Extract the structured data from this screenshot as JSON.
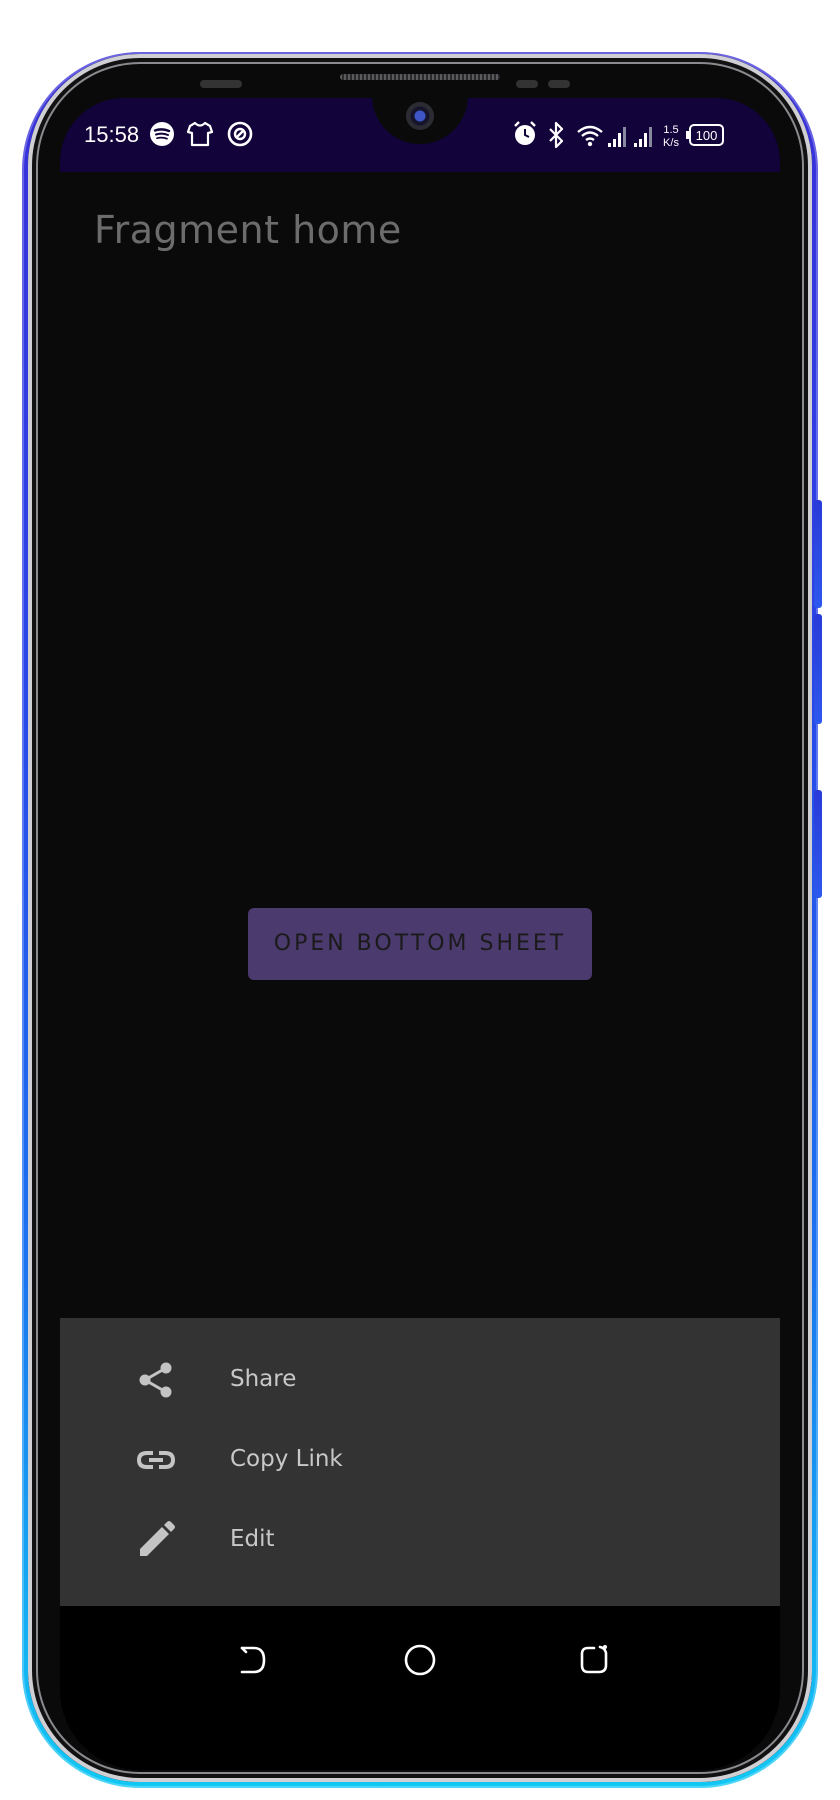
{
  "status_bar": {
    "time": "15:58",
    "left_icons": [
      "spotify-icon",
      "shirt-icon",
      "assistant-icon"
    ],
    "right_icons": [
      "alarm-icon",
      "bluetooth-icon",
      "wifi-icon",
      "signal-icon",
      "signal-icon"
    ],
    "network_speed_value": "1.5",
    "network_speed_unit": "K/s",
    "battery": "100"
  },
  "app": {
    "fragment_title": "Fragment home",
    "open_button_label": "OPEN BOTTOM SHEET",
    "button_color": "#4b3a6d",
    "background_color": "#0a0a0a"
  },
  "bottom_sheet": {
    "background_color": "#333333",
    "items": [
      {
        "label": "Share",
        "icon": "share-icon"
      },
      {
        "label": "Copy Link",
        "icon": "link-icon"
      },
      {
        "label": "Edit",
        "icon": "edit-pencil-icon"
      }
    ]
  },
  "nav_bar": {
    "buttons": [
      "back-icon",
      "home-icon",
      "recents-icon"
    ]
  }
}
